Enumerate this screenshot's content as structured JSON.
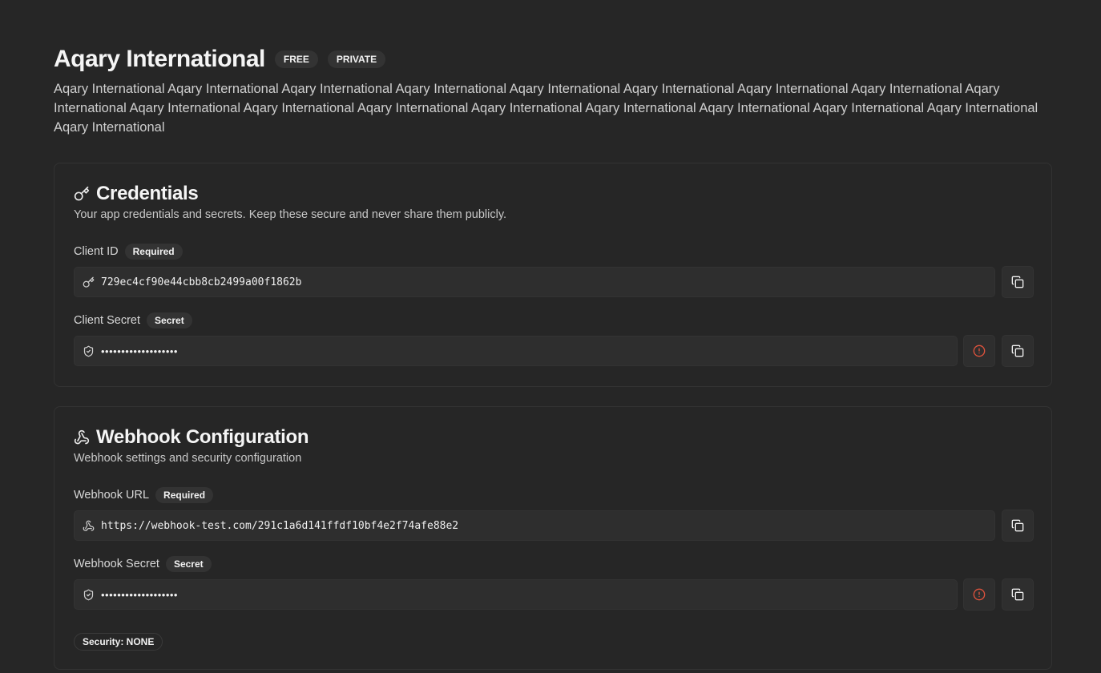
{
  "app": {
    "title": "Aqary International",
    "badges": [
      "FREE",
      "PRIVATE"
    ],
    "description": "Aqary International Aqary International Aqary International Aqary International Aqary International Aqary International Aqary International Aqary International Aqary International Aqary International Aqary International Aqary International Aqary International Aqary International Aqary International Aqary International Aqary International Aqary International"
  },
  "credentials": {
    "title": "Credentials",
    "icon": "key-icon",
    "subtitle": "Your app credentials and secrets. Keep these secure and never share them publicly.",
    "client_id": {
      "label": "Client ID",
      "badge": "Required",
      "value": "729ec4cf90e44cbb8cb2499a00f1862b",
      "icon": "key-icon"
    },
    "client_secret": {
      "label": "Client Secret",
      "badge": "Secret",
      "value": "•••••••••••••••••••",
      "icon": "shield-check-icon"
    }
  },
  "webhook": {
    "title": "Webhook Configuration",
    "icon": "webhook-icon",
    "subtitle": "Webhook settings and security configuration",
    "url": {
      "label": "Webhook URL",
      "badge": "Required",
      "value": "https://webhook-test.com/291c1a6d141ffdf10bf4e2f74afe88e2",
      "icon": "webhook-icon"
    },
    "secret": {
      "label": "Webhook Secret",
      "badge": "Secret",
      "value": "•••••••••••••••••••",
      "icon": "shield-check-icon"
    },
    "security": "Security: NONE"
  },
  "colors": {
    "background": "#262626",
    "input_bg": "#2e2e2e",
    "border": "#333333",
    "warning": "#e0533d"
  }
}
